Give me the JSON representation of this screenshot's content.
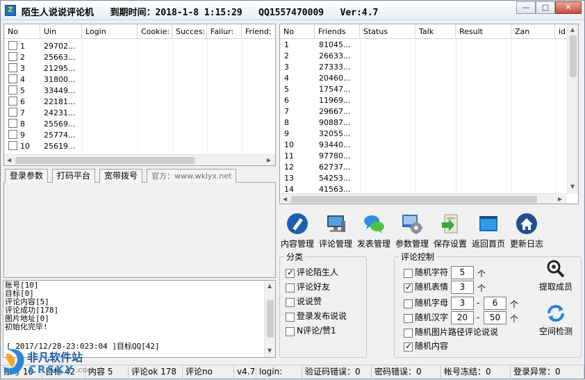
{
  "window": {
    "title": "陌生人说说评论机   到期时间：2018-1-8 1:15:29   QQ1557470009   Ver:4.7",
    "icon_text": "Z",
    "controls": {
      "minimize": "—",
      "maximize": "□",
      "close": "✕"
    }
  },
  "left_table": {
    "columns": [
      "No",
      "Uin",
      "Login",
      "Cookie:",
      "Succes:",
      "Failur:",
      "Friend:"
    ],
    "rows": [
      {
        "no": "1",
        "uin": "29702..."
      },
      {
        "no": "2",
        "uin": "25663..."
      },
      {
        "no": "3",
        "uin": "21295..."
      },
      {
        "no": "4",
        "uin": "31800..."
      },
      {
        "no": "5",
        "uin": "33449..."
      },
      {
        "no": "6",
        "uin": "22181..."
      },
      {
        "no": "7",
        "uin": "24231..."
      },
      {
        "no": "8",
        "uin": "25569..."
      },
      {
        "no": "9",
        "uin": "25774..."
      },
      {
        "no": "10",
        "uin": "25619..."
      }
    ]
  },
  "right_table": {
    "columns": [
      "No",
      "Friends",
      "Status",
      "Talk",
      "Result",
      "Zan",
      "id"
    ],
    "rows": [
      {
        "no": "1",
        "friend": "81045..."
      },
      {
        "no": "2",
        "friend": "26633..."
      },
      {
        "no": "3",
        "friend": "27333..."
      },
      {
        "no": "4",
        "friend": "20460..."
      },
      {
        "no": "5",
        "friend": "17547..."
      },
      {
        "no": "6",
        "friend": "11969..."
      },
      {
        "no": "7",
        "friend": "29667..."
      },
      {
        "no": "8",
        "friend": "90887..."
      },
      {
        "no": "9",
        "friend": "32055..."
      },
      {
        "no": "10",
        "friend": "93440..."
      },
      {
        "no": "11",
        "friend": "97780..."
      },
      {
        "no": "12",
        "friend": "62737..."
      },
      {
        "no": "13",
        "friend": "54253..."
      },
      {
        "no": "14",
        "friend": "41563..."
      }
    ]
  },
  "tabs": [
    "登录参数",
    "打码平台",
    "宽带拨号",
    "官方：www.wklyx.net"
  ],
  "log": {
    "lines": [
      "账号[10]",
      "目标[0]",
      "评论内容[5]",
      "评论成功[178]",
      "图片地址[0]",
      "初始化完毕!"
    ],
    "tail": "[ 2017/12/28-23:023:04 ]目标QQ[42]"
  },
  "toolbar": [
    {
      "label": "内容管理",
      "icon": "pen-icon"
    },
    {
      "label": "评论管理",
      "icon": "computer-icon"
    },
    {
      "label": "发表管理",
      "icon": "chat-bubbles-icon"
    },
    {
      "label": "参数管理",
      "icon": "gear-icon"
    },
    {
      "label": "保存设置",
      "icon": "save-arrow-icon"
    },
    {
      "label": "返回首页",
      "icon": "windows-icon"
    },
    {
      "label": "更新日志",
      "icon": "home-icon"
    }
  ],
  "category": {
    "legend": "分类",
    "options": [
      {
        "label": "评论陌生人",
        "checked": true
      },
      {
        "label": "评论好友",
        "checked": false
      },
      {
        "label": "说说赞",
        "checked": false
      },
      {
        "label": "登录发布说说",
        "checked": false
      },
      {
        "label": "N评论/赞1",
        "checked": false
      }
    ]
  },
  "comment_control": {
    "legend": "评论控制",
    "random_chars": {
      "label": "随机字符",
      "checked": false,
      "value": "5",
      "unit": "个"
    },
    "random_emoji": {
      "label": "随机表情",
      "checked": true,
      "value": "3",
      "unit": "个"
    },
    "random_letters": {
      "label": "随机字母",
      "checked": false,
      "from": "3",
      "to": "6",
      "dash": "-",
      "unit": "个"
    },
    "random_hanzi": {
      "label": "随机汉字",
      "checked": false,
      "from": "20",
      "to": "50",
      "dash": "-",
      "unit": "个"
    },
    "random_image_path": {
      "label": "随机图片路径评论说说",
      "checked": false
    },
    "random_content": {
      "label": "随机内容",
      "checked": true
    }
  },
  "side_buttons": {
    "fetch_members": "提取成员",
    "space_check": "空间检测"
  },
  "statusbar": {
    "account_label": "账号",
    "account_value": "10",
    "target_label": "目标",
    "target_value": "42",
    "content_label": "内容",
    "content_value": "5",
    "comment_ok_label": "评论ok",
    "comment_ok_value": "178",
    "comment_no_label": "评论no",
    "comment_no_value": "",
    "version": "v4.7",
    "login_label": "login:",
    "captcha_err": "验证码错误：0",
    "password_err": "密码错误：0",
    "frozen": "帐号冻结：0",
    "login_abnormal": "登录异常：0"
  },
  "watermark": {
    "cn": "非凡软件站",
    "en": "CRSKY",
    "domain": ".com"
  },
  "colors": {
    "accent": "#1a72c7",
    "title_bg": "#e7eef6",
    "close_red": "#c74b36"
  }
}
